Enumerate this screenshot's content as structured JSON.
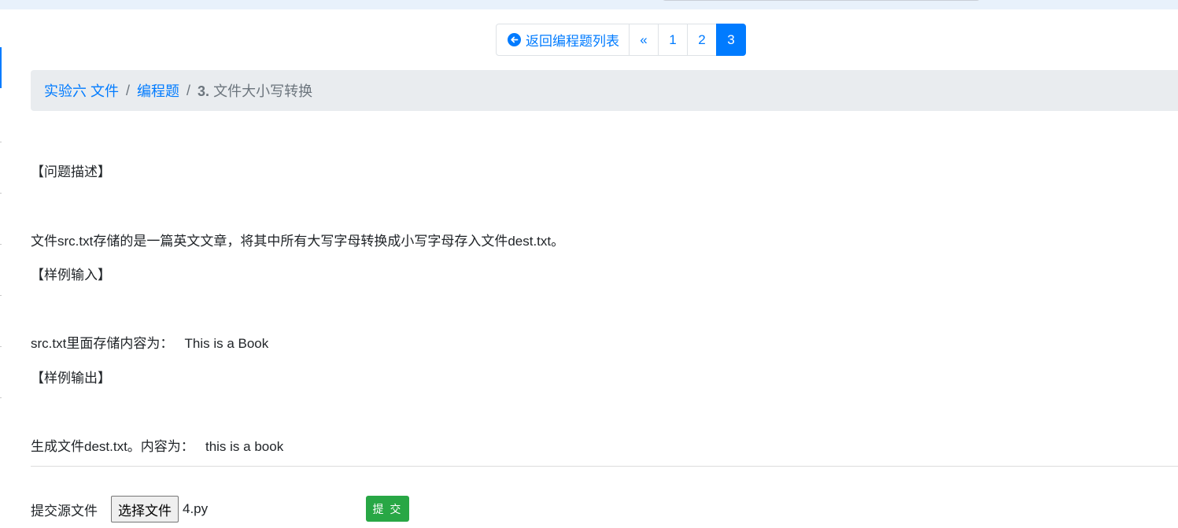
{
  "pagination": {
    "back_label": "返回编程题列表",
    "prev": "«",
    "pages": [
      "1",
      "2",
      "3"
    ],
    "active_page": "3"
  },
  "breadcrumb": {
    "items": [
      "实验六 文件",
      "编程题"
    ],
    "current_number": "3.",
    "current_title": "文件大小写转换",
    "separator": "/"
  },
  "problem": {
    "desc_heading": "【问题描述】",
    "desc_text": "文件src.txt存储的是一篇英文文章，将其中所有大写字母转换成小写字母存入文件dest.txt。",
    "input_heading": "【样例输入】",
    "input_text": "src.txt里面存储内容为：   This is a Book",
    "output_heading": "【样例输出】",
    "output_text": "生成文件dest.txt。内容为：   this is a book"
  },
  "submit": {
    "label": "提交源文件",
    "choose_file": "选择文件",
    "file_name": "4.py",
    "submit_button": "提 交"
  },
  "colors": {
    "primary": "#007bff",
    "success": "#28a745",
    "breadcrumb_bg": "#e9ecef"
  }
}
